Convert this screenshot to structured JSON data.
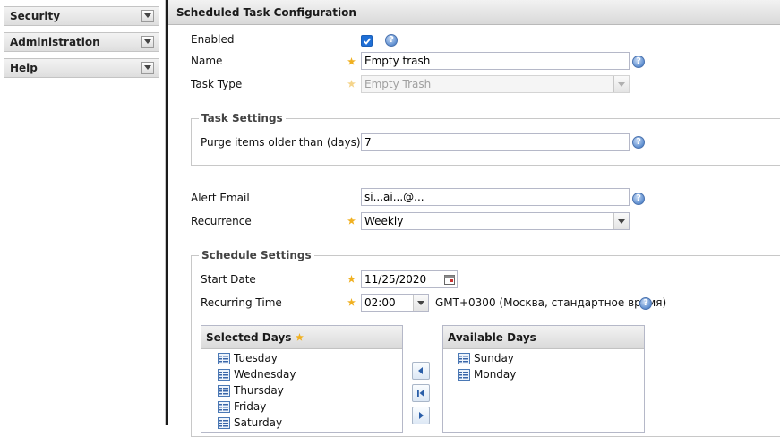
{
  "sidebar": {
    "panels": [
      {
        "label": "Security"
      },
      {
        "label": "Administration"
      },
      {
        "label": "Help"
      }
    ]
  },
  "main": {
    "title": "Scheduled Task Configuration",
    "enabled": {
      "label": "Enabled",
      "checked": true
    },
    "name": {
      "label": "Name",
      "value": "Empty trash"
    },
    "task_type": {
      "label": "Task Type",
      "value": "Empty Trash"
    },
    "task_settings": {
      "legend": "Task Settings",
      "purge": {
        "label": "Purge items older than (days)",
        "value": "7"
      }
    },
    "alert_email": {
      "label": "Alert Email",
      "value": "sі...аі...@..."
    },
    "recurrence": {
      "label": "Recurrence",
      "value": "Weekly"
    },
    "schedule_settings": {
      "legend": "Schedule Settings",
      "start_date": {
        "label": "Start Date",
        "value": "11/25/2020"
      },
      "recurring_time": {
        "label": "Recurring Time",
        "value": "02:00",
        "timezone": "GMT+0300 (Москва, стандартное время)"
      },
      "selected_days": {
        "title": "Selected Days",
        "items": [
          "Tuesday",
          "Wednesday",
          "Thursday",
          "Friday",
          "Saturday"
        ]
      },
      "available_days": {
        "title": "Available Days",
        "items": [
          "Sunday",
          "Monday"
        ]
      }
    }
  },
  "colors": {
    "accent": "#1f6fd6",
    "required_star": "#f0b020",
    "header_bg": "#e3e3e3"
  }
}
